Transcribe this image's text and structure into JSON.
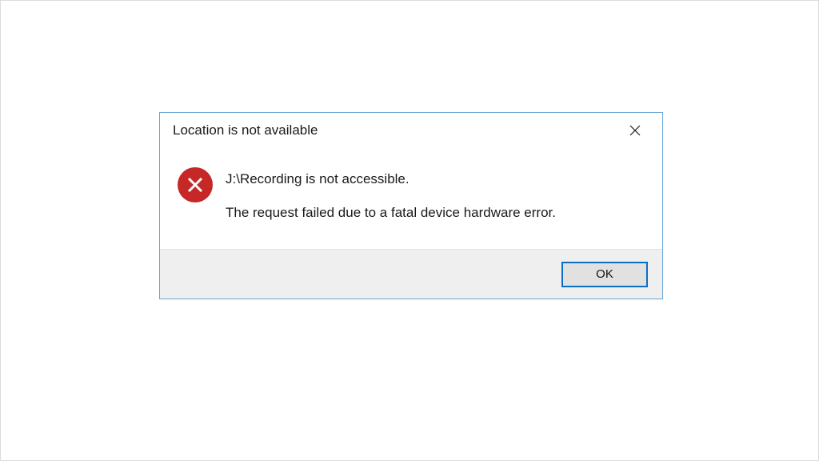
{
  "dialog": {
    "title": "Location is not available",
    "message_line_1": "J:\\Recording is not accessible.",
    "message_line_2": "The request failed due to a fatal device hardware error.",
    "ok_label": "OK",
    "icon_name": "error-icon",
    "close_icon_name": "close-icon",
    "colors": {
      "border": "#6aa6d6",
      "error_circle": "#c62828",
      "ok_border": "#0a6fc2",
      "actionbar_bg": "#efefef"
    }
  }
}
